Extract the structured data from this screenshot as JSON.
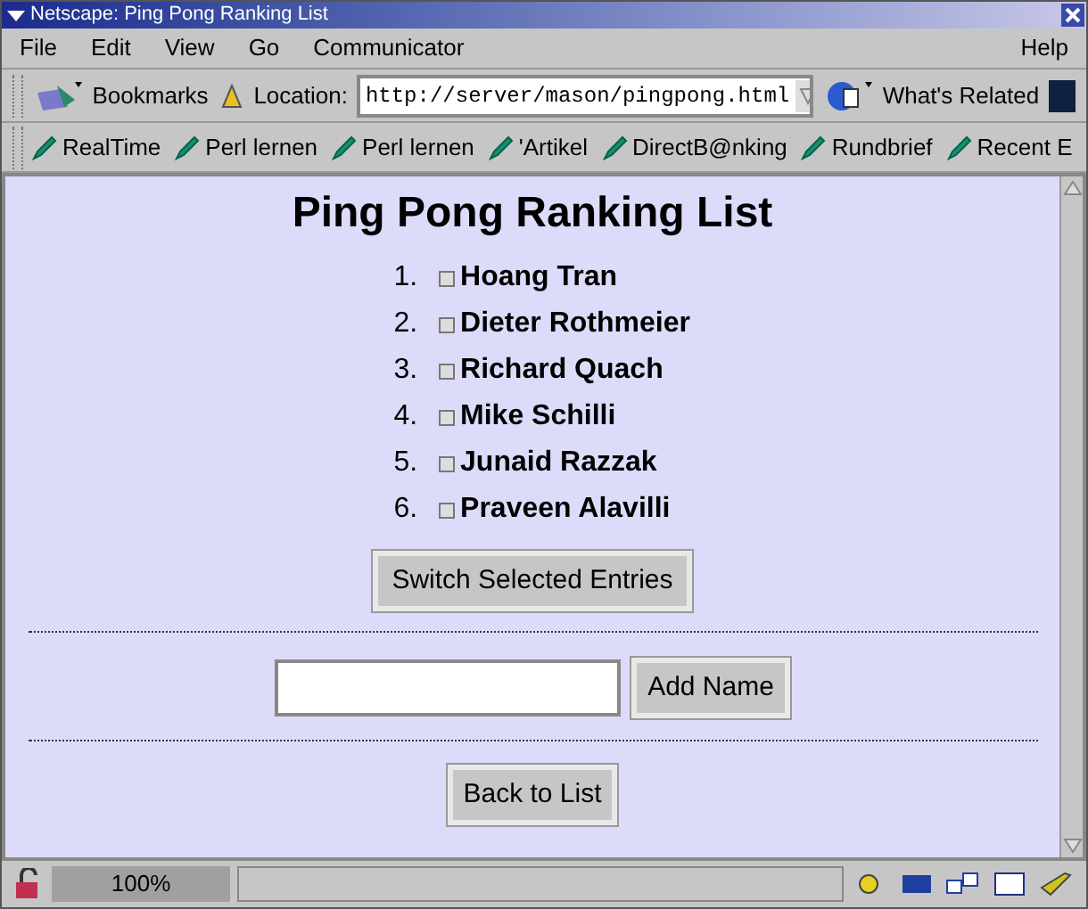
{
  "window": {
    "title": "Netscape: Ping Pong Ranking List"
  },
  "menu": [
    {
      "label": "File"
    },
    {
      "label": "Edit"
    },
    {
      "label": "View"
    },
    {
      "label": "Go"
    },
    {
      "label": "Communicator"
    }
  ],
  "help_menu": {
    "label": "Help"
  },
  "toolbar": {
    "bookmarks": "Bookmarks",
    "location_label": "Location:",
    "location": "http://server/mason/pingpong.html",
    "related": "What's Related"
  },
  "personal_toolbar": [
    {
      "label": "RealTime"
    },
    {
      "label": "Perl lernen"
    },
    {
      "label": "Perl lernen"
    },
    {
      "label": "'Artikel"
    },
    {
      "label": "DirectB@nking"
    },
    {
      "label": "Rundbrief"
    },
    {
      "label": "Recent E"
    }
  ],
  "page": {
    "heading": "Ping Pong Ranking List",
    "entries": [
      {
        "rank": "1.",
        "name": "Hoang Tran",
        "checked": false
      },
      {
        "rank": "2.",
        "name": "Dieter Rothmeier",
        "checked": false
      },
      {
        "rank": "3.",
        "name": "Richard Quach",
        "checked": false
      },
      {
        "rank": "4.",
        "name": "Mike Schilli",
        "checked": false
      },
      {
        "rank": "5.",
        "name": "Junaid Razzak",
        "checked": false
      },
      {
        "rank": "6.",
        "name": "Praveen Alavilli",
        "checked": false
      }
    ],
    "switch_button": "Switch Selected Entries",
    "add_button": "Add Name",
    "back_button": "Back to List"
  },
  "status_bar": {
    "zoom": "100%"
  }
}
